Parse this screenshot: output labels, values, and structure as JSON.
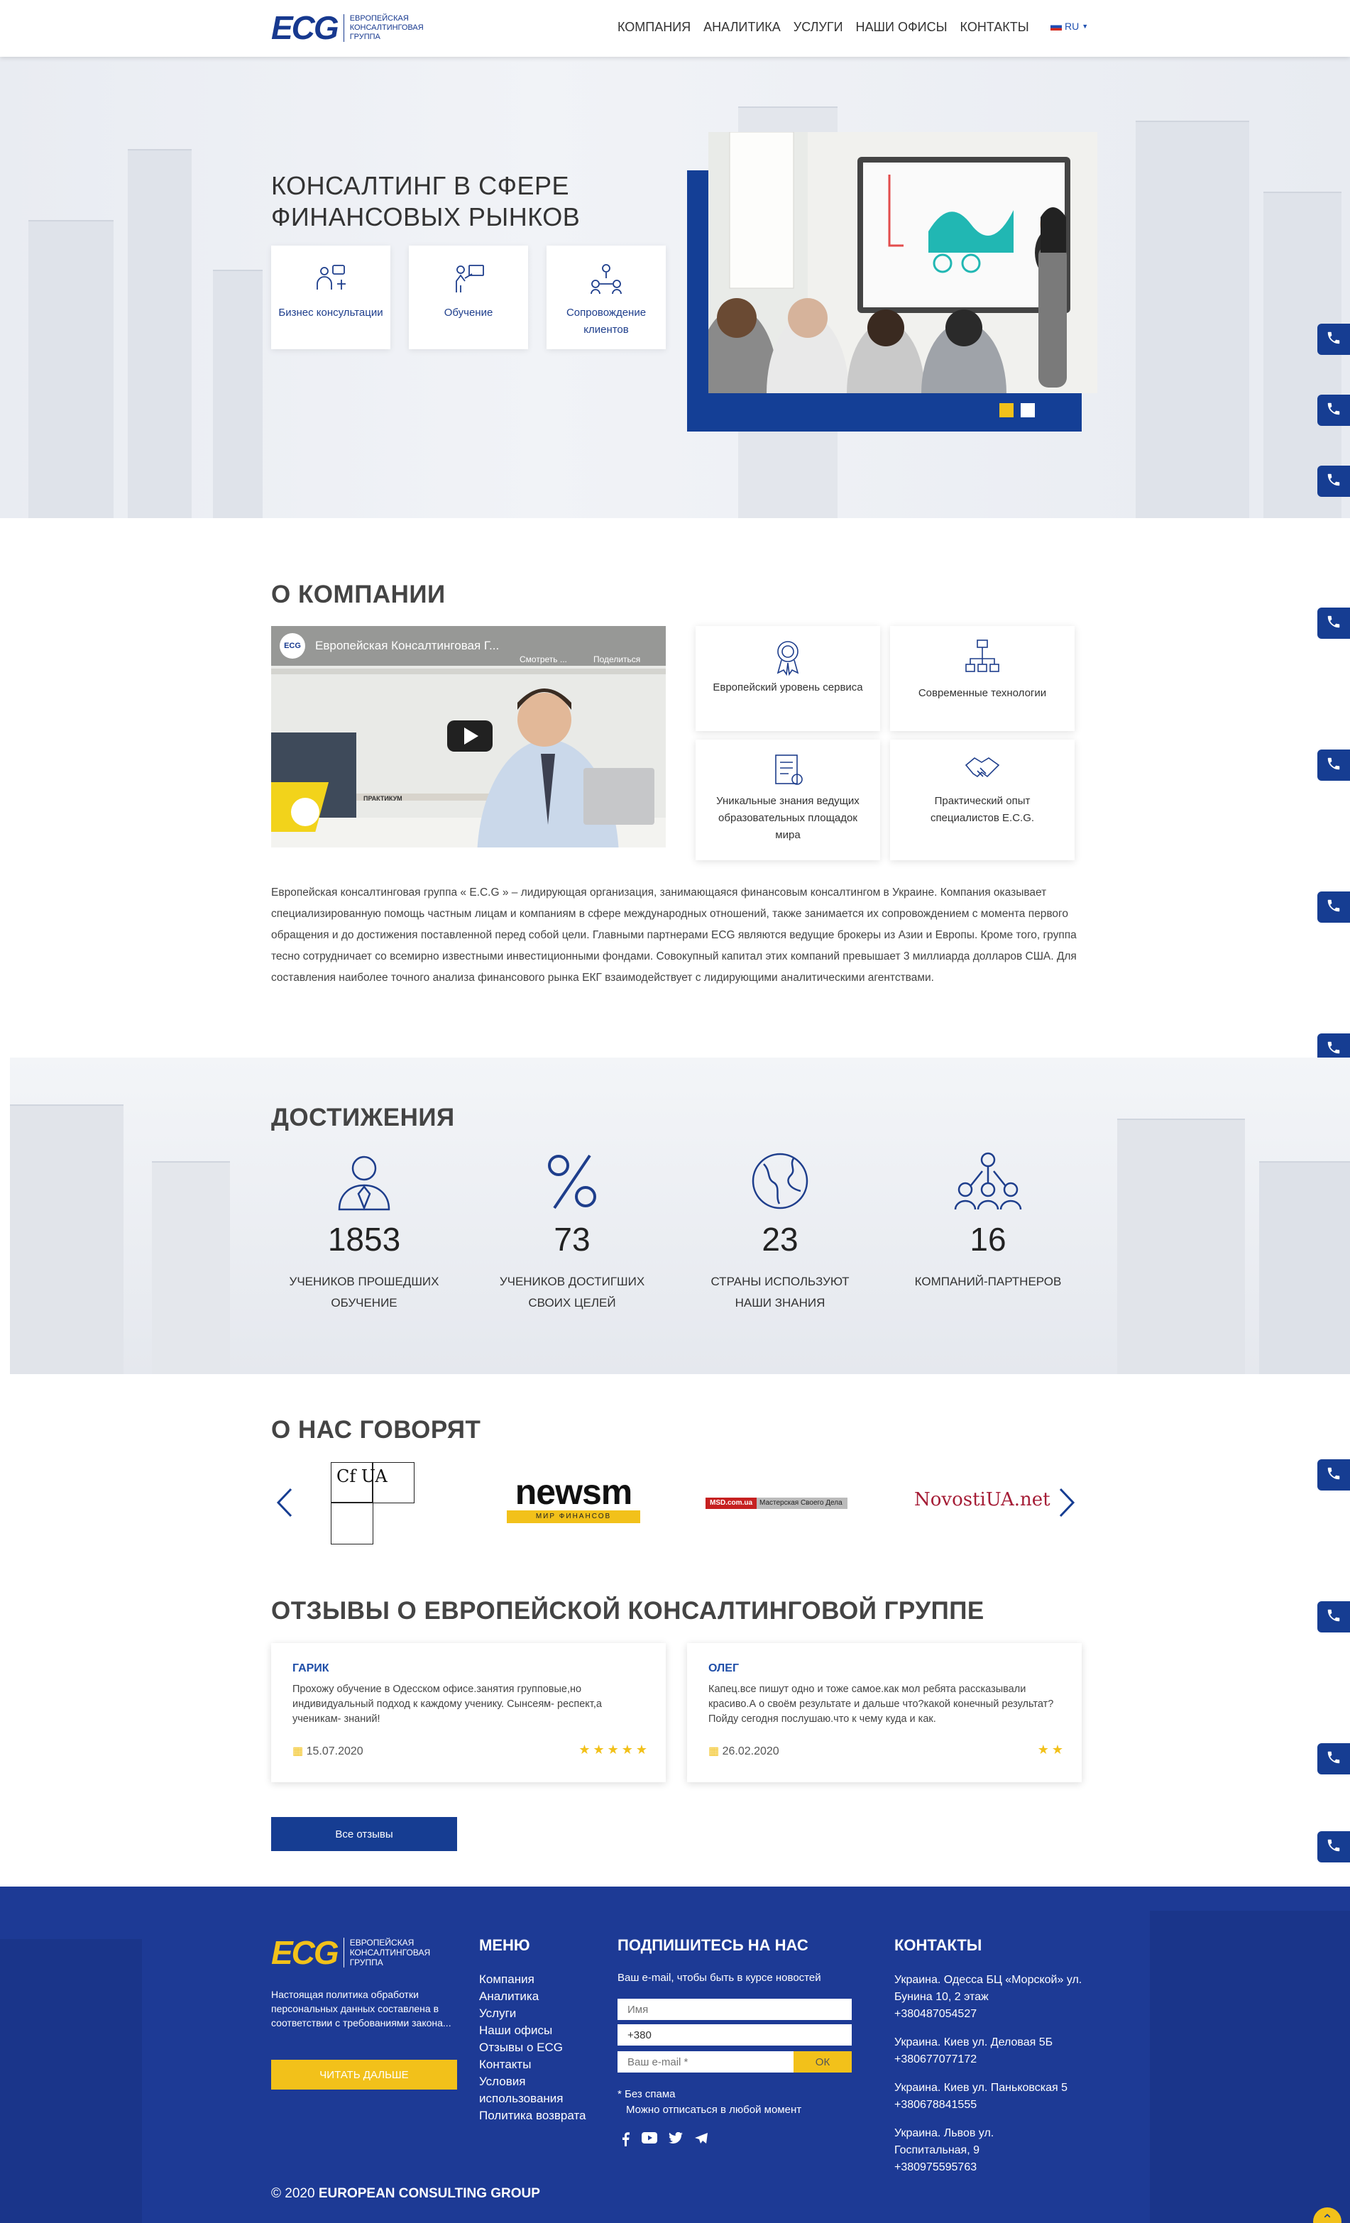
{
  "header": {
    "logo_mark": "ECG",
    "logo_lines": [
      "ЕВРОПЕЙСКАЯ",
      "КОНСАЛТИНГОВАЯ",
      "ГРУППА"
    ],
    "nav": [
      "КОМПАНИЯ",
      "АНАЛИТИКА",
      "УСЛУГИ",
      "НАШИ ОФИСЫ",
      "КОНТАКТЫ"
    ],
    "lang": "RU"
  },
  "hero": {
    "title": "КОНСАЛТИНГ В СФЕРЕ ФИНАНСОВЫХ РЫНКОВ",
    "cards": [
      {
        "label": "Бизнес консультации",
        "icon": "business-consulting-icon"
      },
      {
        "label": "Обучение",
        "icon": "training-icon"
      },
      {
        "label": "Сопровождение клиентов",
        "icon": "client-support-icon"
      }
    ],
    "slide_count": 2,
    "active_slide": 0
  },
  "about": {
    "title": "О КОМПАНИИ",
    "video_title": "Европейская Консалтинговая Г...",
    "video_watch": "Смотреть ...",
    "video_share": "Поделиться",
    "video_tag": "ПРАКТИКУМ",
    "features": [
      {
        "label": "Европейский уровень сервиса",
        "icon": "award-icon"
      },
      {
        "label": "Современные технологии",
        "icon": "network-icon"
      },
      {
        "label": "Уникальные знания ведущих образовательных площадок мира",
        "icon": "document-icon"
      },
      {
        "label": "Практический опыт специалистов E.C.G.",
        "icon": "handshake-icon"
      }
    ],
    "text": "Европейская консалтинговая группа « E.C.G » – лидирующая организация, занимающаяся финансовым консалтингом в Украине. Компания оказывает специализированную помощь частным лицам и компаниям в сфере международных отношений, также занимается их сопровождением с момента первого обращения и до достижения поставленной перед собой цели. Главными партнерами ECG являются ведущие брокеры из Азии и Европы. Кроме того, группа тесно сотрудничает со всемирно известными инвестиционными фондами. Совокупный капитал этих компаний превышает 3 миллиарда долларов США. Для составления наиболее точного анализа финансового рынка ЕКГ взаимодействует с лидирующими аналитическими агентствами."
  },
  "achievements": {
    "title": "ДОСТИЖЕНИЯ",
    "items": [
      {
        "num": "1853",
        "label": "УЧЕНИКОВ ПРОШЕДШИХ ОБУЧЕНИЕ",
        "icon": "student-icon"
      },
      {
        "num": "73",
        "label": "УЧЕНИКОВ ДОСТИГШИХ СВОИХ ЦЕЛЕЙ",
        "icon": "percent-icon"
      },
      {
        "num": "23",
        "label": "СТРАНЫ ИСПОЛЬЗУЮТ НАШИ ЗНАНИЯ",
        "icon": "globe-icon"
      },
      {
        "num": "16",
        "label": "КОМПАНИЙ-ПАРТНЕРОВ",
        "icon": "partners-icon"
      }
    ]
  },
  "press": {
    "title": "О НАС ГОВОРЯТ",
    "logos": [
      "Cf UA",
      "newsm",
      "МИР ФИНАНСОВ",
      "MSD.com.ua",
      "Мастерская Своего Дела",
      "NovostiUA.net"
    ]
  },
  "reviews": {
    "title": "ОТЗЫВЫ О ЕВРОПЕЙСКОЙ КОНСАЛТИНГОВОЙ ГРУППЕ",
    "items": [
      {
        "name": "ГАРИК",
        "text": "Прохожу обучение в Одесском офисе.занятия групповые,но индивидуальный подход к каждому ученику. Сынсеям- респект,а ученикам- знаний!",
        "date": "15.07.2020",
        "stars": "★★★★★"
      },
      {
        "name": "ОЛЕГ",
        "text": "Капец.все пишут одно и тоже самое.как мол ребята рассказывали красиво.А о своём результате и дальше что?какой конечный результат? Пойду сегодня послушаю.что к чему куда и как.",
        "date": "26.02.2020",
        "stars": "★★"
      }
    ],
    "all_button": "Все отзывы"
  },
  "footer": {
    "logo_mark": "ECG",
    "logo_lines": [
      "ЕВРОПЕЙСКАЯ",
      "КОНСАЛТИНГОВАЯ",
      "ГРУППА"
    ],
    "policy": "Настоящая политика обработки персональных данных составлена в соответствии с требованиями закона...",
    "read_more": "ЧИТАТЬ ДАЛЬШЕ",
    "menu_title": "МЕНЮ",
    "menu": [
      "Компания",
      "Аналитика",
      "Услуги",
      "Наши офисы",
      "Отзывы о ECG",
      "Контакты",
      "Условия использования",
      "Политика возврата"
    ],
    "subscribe_title": "ПОДПИШИТЕСЬ НА НАС",
    "subscribe_sub": "Ваш e-mail, чтобы быть в курсе новостей",
    "name_placeholder": "Имя",
    "phone_value": "+380",
    "email_placeholder": "Ваш e-mail *",
    "ok": "ОК",
    "no_spam": "* Без спама",
    "unsubscribe": "Можно отписаться в любой момент",
    "contacts_title": "КОНТАКТЫ",
    "contacts": [
      {
        "addr": "Украина. Одесса БЦ «Морской» ул. Бунина 10, 2 этаж",
        "phone": "+380487054527"
      },
      {
        "addr": "Украина. Киев ул. Деловая 5Б",
        "phone": "+380677077172"
      },
      {
        "addr": "Украина. Киев ул. Паньковская 5",
        "phone": "+380678841555"
      },
      {
        "addr": "Украина. Львов ул. Госпитальная, 9",
        "phone": "+380975595763"
      }
    ],
    "copyright": "© 2020",
    "copyright_brand": "EUROPEAN CONSULTING GROUP"
  },
  "colors": {
    "primary": "#163d92",
    "accent": "#f2c11a"
  }
}
